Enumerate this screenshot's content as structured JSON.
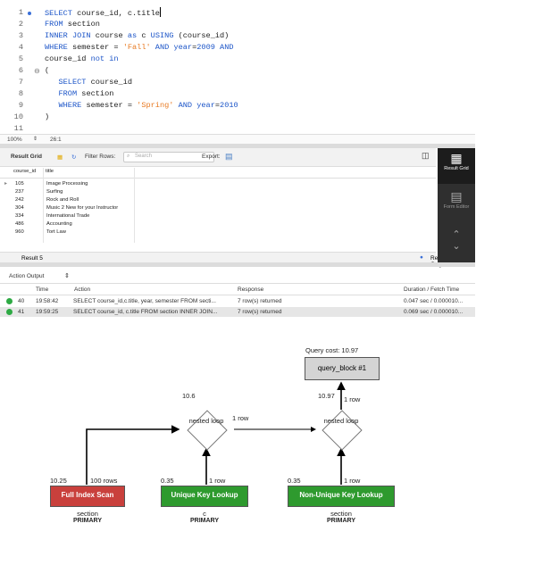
{
  "editor": {
    "lines": [
      {
        "n": "1",
        "parts": [
          [
            "kw",
            "SELECT "
          ],
          [
            "",
            "course_id, c.title"
          ]
        ]
      },
      {
        "n": "2",
        "parts": [
          [
            "kw",
            "FROM "
          ],
          [
            "",
            "section"
          ]
        ]
      },
      {
        "n": "3",
        "parts": [
          [
            "kw",
            "INNER JOIN "
          ],
          [
            "",
            "course "
          ],
          [
            "kw",
            "as "
          ],
          [
            "",
            "c "
          ],
          [
            "kw",
            "USING "
          ],
          [
            "",
            "(course_id)"
          ]
        ]
      },
      {
        "n": "4",
        "parts": [
          [
            "kw",
            "WHERE "
          ],
          [
            "",
            "semester = "
          ],
          [
            "str",
            "'Fall' "
          ],
          [
            "kw",
            "AND "
          ],
          [
            "kw",
            "year"
          ],
          [
            "",
            "="
          ],
          [
            "kw",
            "2009 "
          ],
          [
            "kw",
            "AND"
          ]
        ]
      },
      {
        "n": "5",
        "parts": [
          [
            "",
            "course_id "
          ],
          [
            "kw",
            "not in"
          ]
        ]
      },
      {
        "n": "6",
        "parts": [
          [
            "",
            "("
          ]
        ]
      },
      {
        "n": "7",
        "parts": [
          [
            "",
            "   "
          ],
          [
            "kw",
            "SELECT "
          ],
          [
            "",
            "course_id"
          ]
        ]
      },
      {
        "n": "8",
        "parts": [
          [
            "",
            "   "
          ],
          [
            "kw",
            "FROM "
          ],
          [
            "",
            "section"
          ]
        ]
      },
      {
        "n": "9",
        "parts": [
          [
            "",
            "   "
          ],
          [
            "kw",
            "WHERE "
          ],
          [
            "",
            "semester = "
          ],
          [
            "str",
            "'Spring' "
          ],
          [
            "kw",
            "AND "
          ],
          [
            "kw",
            "year"
          ],
          [
            "",
            "="
          ],
          [
            "kw",
            "2010"
          ]
        ]
      },
      {
        "n": "10",
        "parts": [
          [
            "",
            ")"
          ]
        ]
      },
      {
        "n": "11",
        "parts": []
      }
    ],
    "zoom": "100%",
    "cursor_pos": "26:1"
  },
  "result_toolbar": {
    "result_grid_label": "Result Grid",
    "filter_rows_label": "Filter Rows:",
    "search_placeholder": "Search",
    "export_label": "Export:"
  },
  "grid": {
    "columns": [
      "course_id",
      "title"
    ],
    "rows": [
      [
        "105",
        "Image Processing"
      ],
      [
        "237",
        "Surfing"
      ],
      [
        "242",
        "Rock and Roll"
      ],
      [
        "304",
        "Music 2 New for your Instructor"
      ],
      [
        "334",
        "International Trade"
      ],
      [
        "486",
        "Accounting"
      ],
      [
        "960",
        "Tort Law"
      ]
    ]
  },
  "side_panel": {
    "result_grid": "Result Grid",
    "form_editor": "Form Editor"
  },
  "result_tab": "Result 5",
  "read_only": "Read Only",
  "action_output": {
    "label": "Action Output",
    "headers": [
      "Time",
      "Action",
      "Response",
      "Duration / Fetch Time"
    ],
    "rows": [
      {
        "n": "40",
        "time": "19:58:42",
        "action": "SELECT course_id,c.title, year, semester FROM secti...",
        "response": "7 row(s) returned",
        "duration": "0.047 sec / 0.000010..."
      },
      {
        "n": "41",
        "time": "19:59:25",
        "action": "SELECT course_id, c.title FROM section INNER JOIN...",
        "response": "7 row(s) returned",
        "duration": "0.069 sec / 0.000010..."
      }
    ]
  },
  "plan": {
    "query_cost": "Query cost: 10.97",
    "query_block": "query_block #1",
    "nested_loop_1": {
      "label": "nested loop",
      "cost": "10.6"
    },
    "nested_loop_2": {
      "label": "nested loop",
      "cost": "10.97"
    },
    "edge_1row_a": "1 row",
    "edge_1row_b": "1 row",
    "full_scan": {
      "label": "Full Index Scan",
      "cost": "10.25",
      "rows": "100 rows",
      "table": "section",
      "key": "PRIMARY"
    },
    "unique_lookup": {
      "label": "Unique Key Lookup",
      "cost": "0.35",
      "rows": "1 row",
      "table": "c",
      "key": "PRIMARY"
    },
    "nonunique_lookup": {
      "label": "Non-Unique Key Lookup",
      "cost": "0.35",
      "rows": "1 row",
      "table": "section",
      "key": "PRIMARY"
    },
    "colors": {
      "full_scan": "#c9403c",
      "lookup": "#2e9a2e"
    }
  }
}
